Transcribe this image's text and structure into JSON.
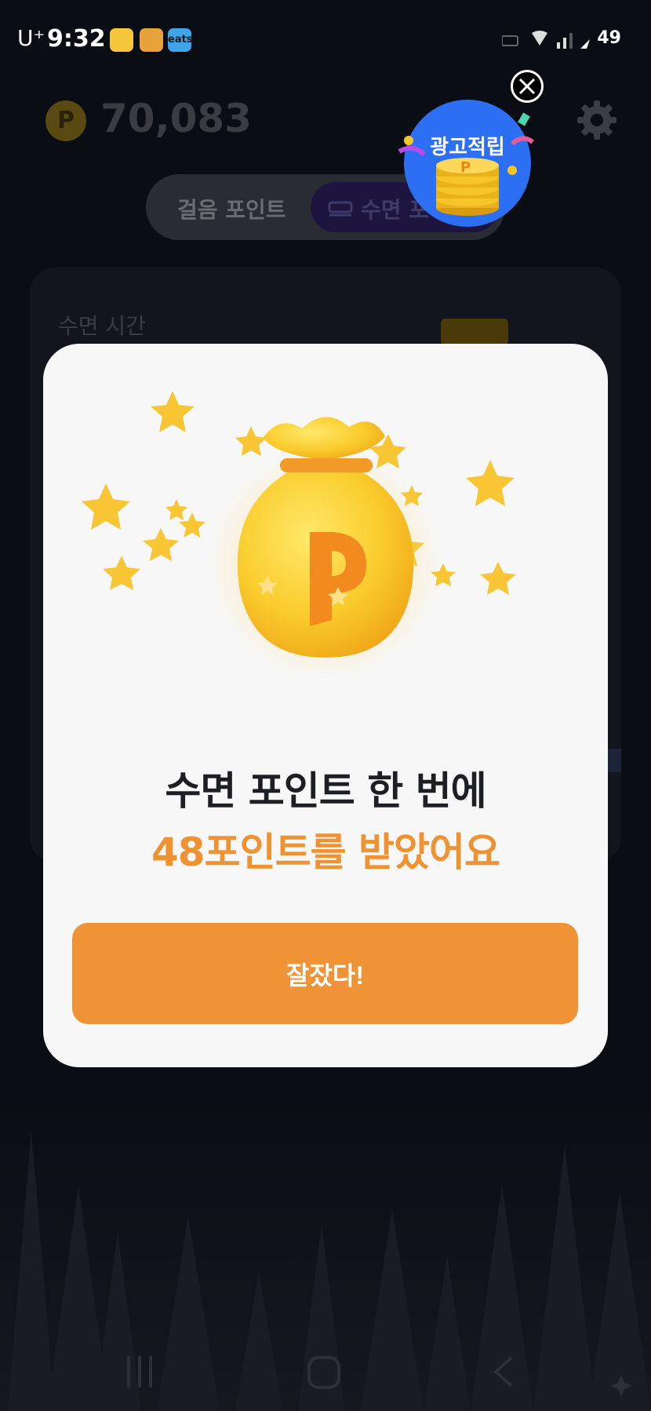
{
  "status_bar": {
    "carrier": "U⁺",
    "time": "9:32",
    "apps": [
      "sun-app-icon",
      "bread-app-icon",
      "eats"
    ],
    "battery": "49"
  },
  "header": {
    "points": "70,083",
    "coin_letter": "P"
  },
  "tabs": {
    "walk_label": "걸음 포인트",
    "sleep_label": "수면 포"
  },
  "background_card": {
    "title": "수면 시간"
  },
  "ad_bubble": {
    "label": "광고적립",
    "coin_letter": "P"
  },
  "modal": {
    "bag_letter": "P",
    "headline": "수면 포인트 한 번에",
    "subline": "48포인트를 받았어요",
    "confirm_label": "잘잤다!"
  },
  "colors": {
    "accent_orange": "#ef9336",
    "modal_bg": "#f7f7f7",
    "ad_blue": "#2d6ff3",
    "coin_yellow": "#f6c52a"
  }
}
